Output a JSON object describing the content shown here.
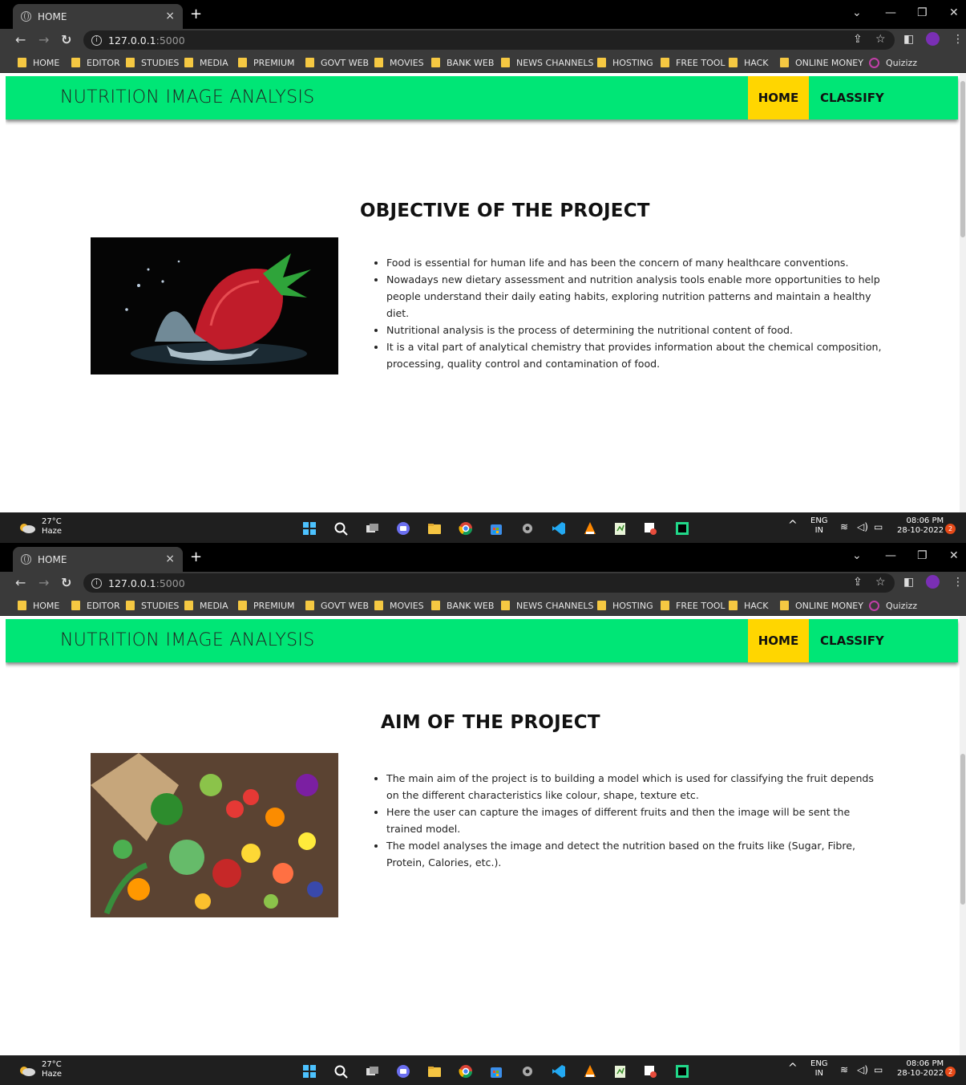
{
  "browser": {
    "tab_title": "HOME",
    "tab_close": "×",
    "new_tab": "+",
    "url_host": "127.0.0.1",
    "url_port": ":5000",
    "bookmarks": [
      "HOME",
      "EDITOR",
      "STUDIES",
      "MEDIA",
      "PREMIUM",
      "GOVT WEB",
      "MOVIES",
      "BANK WEB",
      "NEWS CHANNELS",
      "HOSTING",
      "FREE TOOL",
      "HACK",
      "ONLINE MONEY",
      "Quizizz"
    ]
  },
  "site": {
    "brand": "NUTRITION IMAGE ANALYSIS",
    "nav_home": "HOME",
    "nav_classify": "CLASSIFY",
    "accent_green": "#00e676",
    "accent_yellow": "#ffd600"
  },
  "objective": {
    "title": "OBJECTIVE OF THE PROJECT",
    "image_label": "strawberry splash photo",
    "bullets": [
      "Food is essential for human life and has been the concern of many healthcare conventions.",
      "Nowadays new dietary assessment and nutrition analysis tools enable more opportunities to help people understand their daily eating habits, exploring nutrition patterns and maintain a healthy diet.",
      "Nutritional analysis is the process of determining the nutritional content of food.",
      "It is a vital part of analytical chemistry that provides information about the chemical composition, processing, quality control and contamination of food."
    ]
  },
  "aim": {
    "title": "AIM OF THE PROJECT",
    "image_label": "fruits and vegetables photo",
    "bullets": [
      "The main aim of the project is to building a model which is used for classifying the fruit depends on the different characteristics like colour, shape, texture etc.",
      "Here the user can capture the images of different fruits and then the image will be sent the trained model.",
      "The model analyses the image and detect the nutrition based on the fruits like (Sugar, Fibre, Protein, Calories, etc.)."
    ]
  },
  "taskbar": {
    "temp": "27°C",
    "weather": "Haze",
    "lang": "ENG",
    "region": "IN",
    "time": "08:06 PM",
    "date": "28-10-2022",
    "notifications": "2"
  }
}
